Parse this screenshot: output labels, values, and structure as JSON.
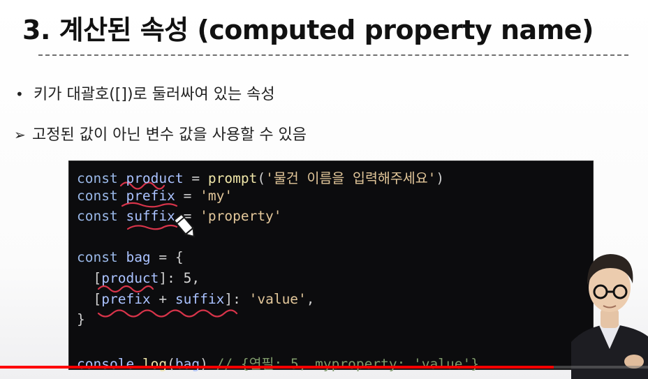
{
  "slide": {
    "title": "3. 계산된 속성 (computed property name)",
    "bullets": [
      {
        "marker": "•",
        "text": "키가 대괄호([])로 둘러싸여 있는 속성"
      },
      {
        "marker": "➢",
        "text": "고정된 값이 아닌 변수 값을 사용할 수 있음"
      }
    ]
  },
  "code": {
    "lines": [
      [
        [
          "kw",
          "const"
        ],
        [
          "pun",
          " "
        ],
        [
          "id",
          "product"
        ],
        [
          "pun",
          " = "
        ],
        [
          "fn",
          "prompt"
        ],
        [
          "pun",
          "("
        ],
        [
          "str",
          "'물건 이름을 입력해주세요'"
        ],
        [
          "pun",
          ")"
        ]
      ],
      [
        [
          "kw",
          "const"
        ],
        [
          "pun",
          " "
        ],
        [
          "id",
          "prefix"
        ],
        [
          "pun",
          " = "
        ],
        [
          "str",
          "'my'"
        ]
      ],
      [
        [
          "kw",
          "const"
        ],
        [
          "pun",
          " "
        ],
        [
          "id",
          "suffix"
        ],
        [
          "pun",
          " = "
        ],
        [
          "str",
          "'property'"
        ]
      ],
      [],
      [
        [
          "kw",
          "const"
        ],
        [
          "pun",
          " "
        ],
        [
          "id",
          "bag"
        ],
        [
          "pun",
          " = {"
        ]
      ],
      [
        [
          "pun",
          "  ["
        ],
        [
          "id",
          "product"
        ],
        [
          "pun",
          "]: "
        ],
        [
          "num",
          "5"
        ],
        [
          "pun",
          ","
        ]
      ],
      [
        [
          "pun",
          "  ["
        ],
        [
          "id",
          "prefix"
        ],
        [
          "pun",
          " + "
        ],
        [
          "id",
          "suffix"
        ],
        [
          "pun",
          "]: "
        ],
        [
          "str",
          "'value'"
        ],
        [
          "pun",
          ","
        ]
      ],
      [
        [
          "pun",
          "}"
        ]
      ],
      [],
      [
        [
          "id",
          "console"
        ],
        [
          "pun",
          "."
        ],
        [
          "fn",
          "log"
        ],
        [
          "pun",
          "("
        ],
        [
          "id",
          "bag"
        ],
        [
          "pun",
          ") "
        ],
        [
          "cmt",
          "// {연필: 5, myproperty: 'value'}"
        ]
      ]
    ]
  },
  "video": {
    "progress": 0.855
  },
  "colors": {
    "progress": "#ff0000",
    "annotation": "#d8344a",
    "code_background": "#0c0c0e"
  }
}
